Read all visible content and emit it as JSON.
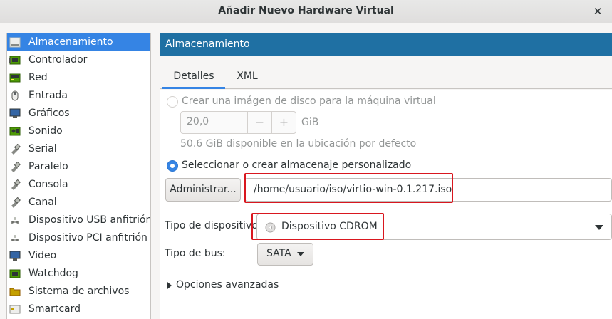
{
  "window": {
    "title": "Añadir Nuevo Hardware Virtual",
    "close_glyph": "✕"
  },
  "sidebar": {
    "items": [
      {
        "label": "Almacenamiento",
        "icon": "storage-icon",
        "selected": true
      },
      {
        "label": "Controlador",
        "icon": "controller-icon"
      },
      {
        "label": "Red",
        "icon": "network-icon"
      },
      {
        "label": "Entrada",
        "icon": "mouse-icon"
      },
      {
        "label": "Gráficos",
        "icon": "display-icon"
      },
      {
        "label": "Sonido",
        "icon": "sound-card-icon"
      },
      {
        "label": "Serial",
        "icon": "serial-plug-icon"
      },
      {
        "label": "Paralelo",
        "icon": "parallel-plug-icon"
      },
      {
        "label": "Consola",
        "icon": "console-plug-icon"
      },
      {
        "label": "Canal",
        "icon": "channel-plug-icon"
      },
      {
        "label": "Dispositivo USB anfitrión",
        "icon": "usb-device-icon"
      },
      {
        "label": "Dispositivo PCI anfitrión",
        "icon": "pci-device-icon"
      },
      {
        "label": "Video",
        "icon": "monitor-icon"
      },
      {
        "label": "Watchdog",
        "icon": "watchdog-chip-icon"
      },
      {
        "label": "Sistema de archivos",
        "icon": "folder-icon"
      },
      {
        "label": "Smartcard",
        "icon": "smartcard-icon"
      }
    ]
  },
  "main": {
    "header": "Almacenamiento",
    "tabs": [
      {
        "label": "Detalles",
        "active": true
      },
      {
        "label": "XML",
        "active": false
      }
    ],
    "create_disk": {
      "label": "Crear una imágen de disco para la máquina virtual",
      "size_value": "20,0",
      "minus": "−",
      "plus": "+",
      "unit": "GiB",
      "available": "50.6 GiB disponible en la ubicación por defecto"
    },
    "custom_storage": {
      "label": "Seleccionar o crear almacenaje personalizado",
      "manage_button": "Administrar...",
      "path": "/home/usuario/iso/virtio-win-0.1.217.iso"
    },
    "device_type": {
      "label": "Tipo de dispositivo:",
      "value": "Dispositivo CDROM",
      "icon": "cdrom-disc-icon"
    },
    "bus_type": {
      "label": "Tipo de bus:",
      "value": "SATA"
    },
    "advanced": {
      "label": "Opciones avanzadas"
    }
  },
  "colors": {
    "accent": "#3584e4",
    "header_bg": "#1f70a3",
    "highlight": "#d9171f"
  }
}
